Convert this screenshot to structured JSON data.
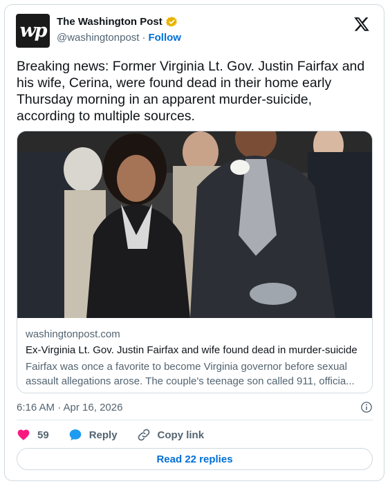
{
  "author": {
    "avatar_text": "wp",
    "name": "The Washington Post",
    "handle": "@washingtonpost",
    "separator": "·",
    "follow_label": "Follow",
    "verified_color": "#e8b300"
  },
  "tweet": {
    "text": "Breaking news: Former Virginia Lt. Gov. Justin Fairfax and his wife, Cerina, were found dead in their home early Thursday morning in an apparent murder-suicide, according to multiple sources."
  },
  "link_card": {
    "domain": "washingtonpost.com",
    "title": "Ex-Virginia Lt. Gov. Justin Fairfax and wife found dead in murder-suicide",
    "description": "Fairfax was once a favorite to become Virginia governor before sexual assault allegations arose. The couple's teenage son called 911, officia..."
  },
  "timestamp": "6:16 AM · Apr 16, 2026",
  "actions": {
    "like_count": "59",
    "reply_label": "Reply",
    "copy_link_label": "Copy link"
  },
  "replies_button_label": "Read 22 replies",
  "colors": {
    "accent": "#006fd6",
    "like": "#f91880",
    "reply_icon": "#1d9bf0"
  }
}
